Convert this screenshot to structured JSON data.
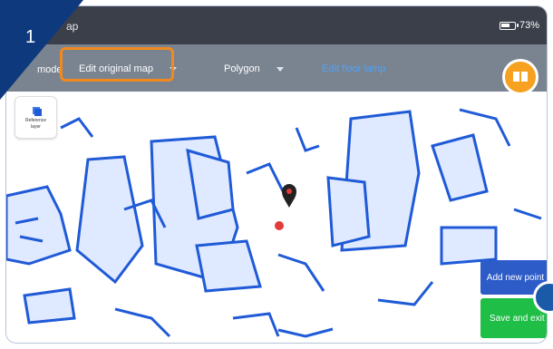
{
  "app": {
    "title": "ap",
    "corner_number": "1",
    "battery": {
      "label": "73%",
      "fill": 0.73
    }
  },
  "toolbar": {
    "mode_label": "mode",
    "original_map": "Edit original map",
    "shape": "Polygon",
    "edit_floor_lamp": "Edit floor lamp"
  },
  "reference_layer": {
    "label_line1": "Reference",
    "label_line2": "layer"
  },
  "actions": {
    "add_point": "Add new point",
    "save_exit": "Save and exit"
  },
  "colors": {
    "map_blue": "#1f5ad7",
    "map_light": "#dfe9ff",
    "highlight": "#f08a1f",
    "add_button": "#2d5bc8",
    "save_button": "#1fbe46",
    "book_button": "#f6a11f",
    "corner_badge": "#0e3a7d"
  },
  "icons": {
    "pencil": "pencil-icon",
    "trash": "trash-icon",
    "book": "book-icon",
    "pin": "map-pin-icon",
    "robot": "robot-dot",
    "menu": "menu-icon"
  }
}
